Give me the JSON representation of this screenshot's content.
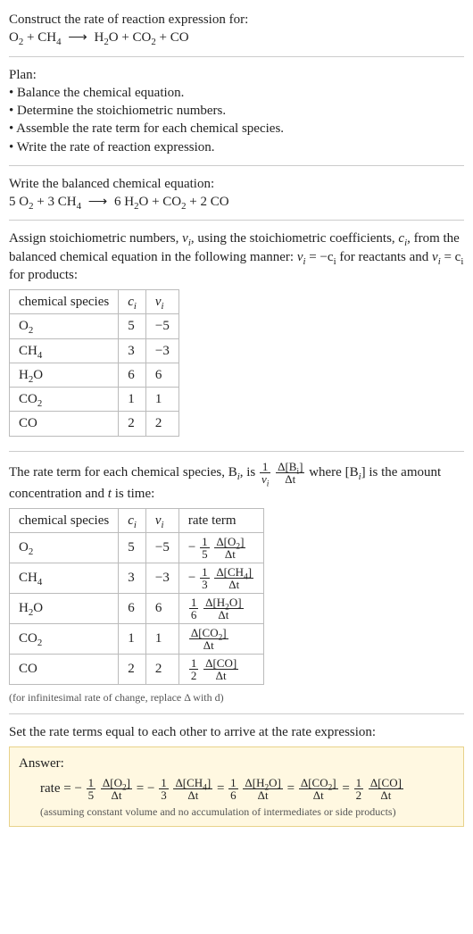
{
  "header": {
    "title": "Construct the rate of reaction expression for:",
    "equation_lhs_1": "O",
    "equation_lhs_1_sub": "2",
    "plus1": " + ",
    "equation_lhs_2": "CH",
    "equation_lhs_2_sub": "4",
    "arrow": "⟶",
    "equation_rhs_1": "H",
    "equation_rhs_1_sub": "2",
    "equation_rhs_1_tail": "O",
    "plus2": " + ",
    "equation_rhs_2": "CO",
    "equation_rhs_2_sub": "2",
    "plus3": " + ",
    "equation_rhs_3": "CO"
  },
  "plan": {
    "label": "Plan:",
    "b1": "• Balance the chemical equation.",
    "b2": "• Determine the stoichiometric numbers.",
    "b3": "• Assemble the rate term for each chemical species.",
    "b4": "• Write the rate of reaction expression."
  },
  "balanced": {
    "title": "Write the balanced chemical equation:",
    "c1": "5 O",
    "c1_sub": "2",
    "plus1": " + ",
    "c2": "3 CH",
    "c2_sub": "4",
    "arrow": "⟶",
    "c3": "6 H",
    "c3_sub": "2",
    "c3_tail": "O",
    "plus2": " + ",
    "c4": "CO",
    "c4_sub": "2",
    "plus3": " + ",
    "c5": "2 CO"
  },
  "assign": {
    "p1a": "Assign stoichiometric numbers, ",
    "nu_i": "ν",
    "nu_i_sub": "i",
    "p1b": ", using the stoichiometric coefficients, ",
    "c_i": "c",
    "c_i_sub": "i",
    "p1c": ", from the balanced chemical equation in the following manner: ",
    "rel1a": "ν",
    "rel1a_sub": "i",
    "rel1b": " = −c",
    "rel1b_sub": "i",
    "p1d": " for reactants and ",
    "rel2a": "ν",
    "rel2a_sub": "i",
    "rel2b": " = c",
    "rel2b_sub": "i",
    "p1e": " for products:"
  },
  "table1": {
    "h1": "chemical species",
    "h2": "c",
    "h2_sub": "i",
    "h3": "ν",
    "h3_sub": "i",
    "r1s": "O",
    "r1s_sub": "2",
    "r1c": "5",
    "r1v": "−5",
    "r2s": "CH",
    "r2s_sub": "4",
    "r2c": "3",
    "r2v": "−3",
    "r3s": "H",
    "r3s_sub": "2",
    "r3s_tail": "O",
    "r3c": "6",
    "r3v": "6",
    "r4s": "CO",
    "r4s_sub": "2",
    "r4c": "1",
    "r4v": "1",
    "r5s": "CO",
    "r5c": "2",
    "r5v": "2"
  },
  "rateterm_intro": {
    "a": "The rate term for each chemical species, B",
    "a_sub": "i",
    "b": ", is ",
    "frac1_num": "1",
    "frac1_den_a": "ν",
    "frac1_den_sub": "i",
    "frac2_num_a": "Δ[B",
    "frac2_num_sub": "i",
    "frac2_num_b": "]",
    "frac2_den": "Δt",
    "c": " where [B",
    "c_sub": "i",
    "d": "] is the amount concentration and ",
    "t": "t",
    "e": " is time:"
  },
  "table2": {
    "h1": "chemical species",
    "h2": "c",
    "h2_sub": "i",
    "h3": "ν",
    "h3_sub": "i",
    "h4": "rate term",
    "r1": {
      "s": "O",
      "s_sub": "2",
      "c": "5",
      "v": "−5",
      "sign": "−",
      "fn": "1",
      "fd": "5",
      "dn": "Δ[O",
      "dn_sub": "2",
      "dn_b": "]",
      "dd": "Δt"
    },
    "r2": {
      "s": "CH",
      "s_sub": "4",
      "c": "3",
      "v": "−3",
      "sign": "−",
      "fn": "1",
      "fd": "3",
      "dn": "Δ[CH",
      "dn_sub": "4",
      "dn_b": "]",
      "dd": "Δt"
    },
    "r3": {
      "s": "H",
      "s_sub": "2",
      "s_tail": "O",
      "c": "6",
      "v": "6",
      "sign": "",
      "fn": "1",
      "fd": "6",
      "dn": "Δ[H",
      "dn_sub": "2",
      "dn_b": "O]",
      "dd": "Δt"
    },
    "r4": {
      "s": "CO",
      "s_sub": "2",
      "c": "1",
      "v": "1",
      "sign": "",
      "fn": "",
      "fd": "",
      "dn": "Δ[CO",
      "dn_sub": "2",
      "dn_b": "]",
      "dd": "Δt"
    },
    "r5": {
      "s": "CO",
      "c": "2",
      "v": "2",
      "sign": "",
      "fn": "1",
      "fd": "2",
      "dn": "Δ[CO]",
      "dd": "Δt"
    }
  },
  "infinitesimal_note": "(for infinitesimal rate of change, replace Δ with d)",
  "final": {
    "title": "Set the rate terms equal to each other to arrive at the rate expression:",
    "answer_label": "Answer:",
    "rate_label": "rate = ",
    "eq": "=",
    "t1": {
      "sign": "−",
      "fn": "1",
      "fd": "5",
      "dn": "Δ[O",
      "dn_sub": "2",
      "dn_b": "]",
      "dd": "Δt"
    },
    "t2": {
      "sign": "−",
      "fn": "1",
      "fd": "3",
      "dn": "Δ[CH",
      "dn_sub": "4",
      "dn_b": "]",
      "dd": "Δt"
    },
    "t3": {
      "fn": "1",
      "fd": "6",
      "dn": "Δ[H",
      "dn_sub": "2",
      "dn_b": "O]",
      "dd": "Δt"
    },
    "t4": {
      "dn": "Δ[CO",
      "dn_sub": "2",
      "dn_b": "]",
      "dd": "Δt"
    },
    "t5": {
      "fn": "1",
      "fd": "2",
      "dn": "Δ[CO]",
      "dd": "Δt"
    },
    "note": "(assuming constant volume and no accumulation of intermediates or side products)"
  }
}
